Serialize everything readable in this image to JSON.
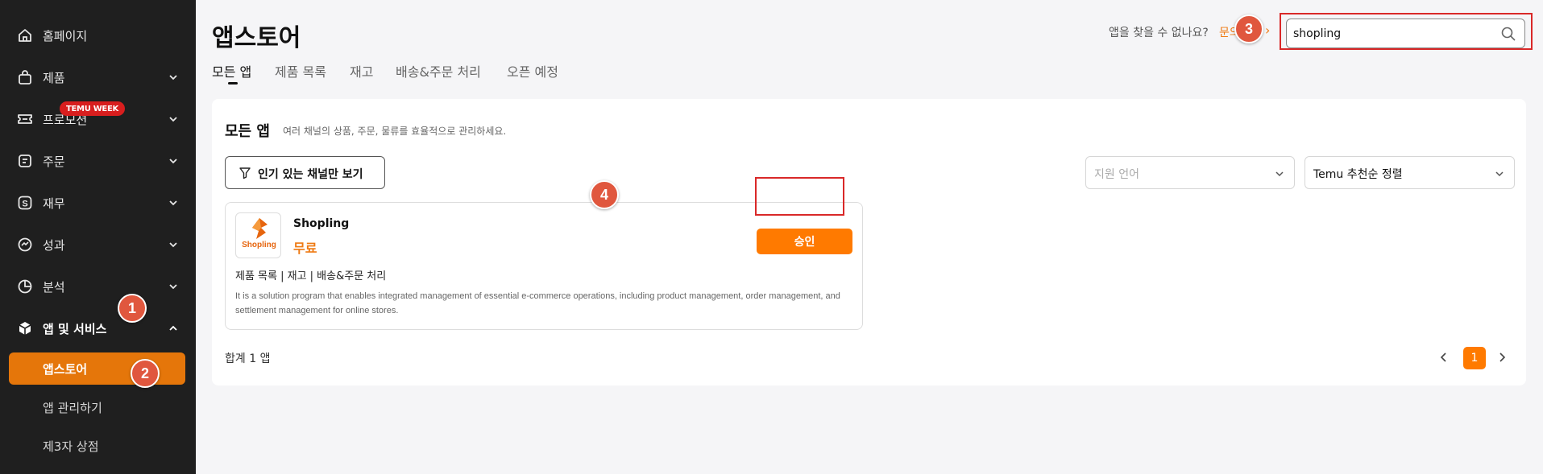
{
  "sidebar": {
    "items": [
      {
        "label": "홈페이지",
        "icon": "home-icon"
      },
      {
        "label": "제품",
        "icon": "bag-icon"
      },
      {
        "label": "프로모션",
        "icon": "ticket-icon",
        "badge": "TEMU WEEK"
      },
      {
        "label": "주문",
        "icon": "order-icon"
      },
      {
        "label": "재무",
        "icon": "dollar-icon"
      },
      {
        "label": "성과",
        "icon": "performance-icon"
      },
      {
        "label": "분석",
        "icon": "pie-chart-icon"
      },
      {
        "label": "앱 및 서비스",
        "icon": "cube-icon"
      }
    ],
    "sub_items": [
      {
        "label": "앱스토어",
        "active": true
      },
      {
        "label": "앱 관리하기",
        "active": false
      },
      {
        "label": "제3자 상점",
        "active": false
      }
    ]
  },
  "markers": [
    "1",
    "2",
    "3",
    "4"
  ],
  "header": {
    "title": "앱스토어",
    "help_text": "앱을 찾을 수 없나요?",
    "help_link": "문의",
    "search_value": "shopling"
  },
  "tabs": [
    {
      "label": "모든 앱",
      "active": true
    },
    {
      "label": "제품 목록",
      "active": false
    },
    {
      "label": "재고",
      "active": false
    },
    {
      "label": "배송&주문 처리",
      "active": false
    },
    {
      "label": "오픈 예정",
      "active": false
    }
  ],
  "main": {
    "section_title": "모든 앱",
    "section_desc": "여러 채널의 상품, 주문, 물류를 효율적으로 관리하세요.",
    "filter_button": "인기 있는 채널만 보기",
    "language_select_placeholder": "지원 언어",
    "sort_select_value": "Temu 추천순 정렬",
    "app": {
      "logo_text": "Shopling",
      "name": "Shopling",
      "price": "무료",
      "categories": "제품 목록 | 재고 | 배송&주문 처리",
      "description": "It is a solution program that enables integrated management of essential e-commerce operations, including product management, order management, and settlement management for online stores.",
      "approve_button": "승인"
    },
    "total": "합계 1 앱",
    "current_page": "1"
  },
  "colors": {
    "accent": "#ff7a00",
    "sidebar_bg": "#1f1f1f",
    "sidebar_active": "#e5760a",
    "marker": "#e0573e",
    "highlight_frame": "#d92828",
    "badge": "#d81e1e"
  }
}
